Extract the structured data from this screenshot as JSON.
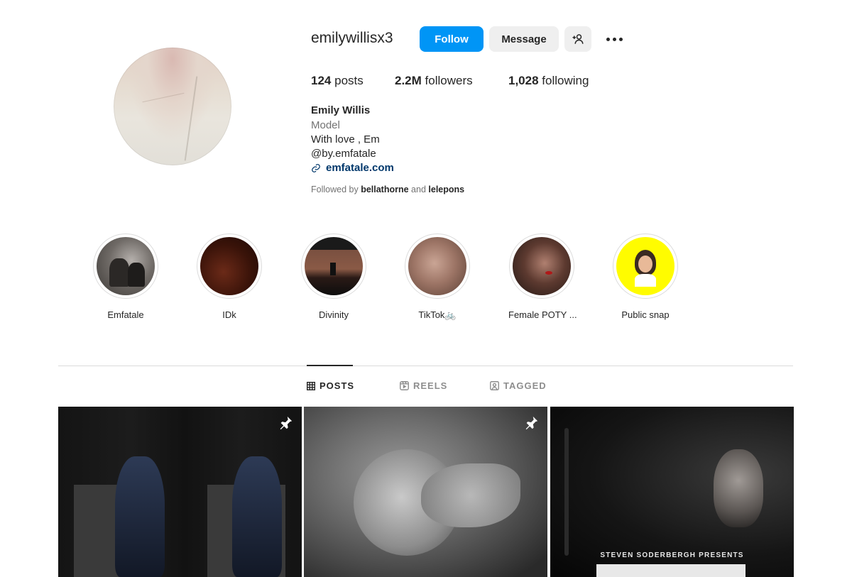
{
  "profile": {
    "username": "emilywillisx3",
    "follow_label": "Follow",
    "message_label": "Message",
    "stats": {
      "posts_count": "124",
      "posts_label": "posts",
      "followers_count": "2.2M",
      "followers_label": "followers",
      "following_count": "1,028",
      "following_label": "following"
    },
    "name": "Emily Willis",
    "category": "Model",
    "bio_lines": [
      "With love , Em",
      "@by.emfatale"
    ],
    "link": "emfatale.com",
    "followed_by": {
      "prefix": "Followed by",
      "user1": "bellathorne",
      "conj": "and",
      "user2": "lelepons"
    }
  },
  "highlights": [
    {
      "label": "Emfatale"
    },
    {
      "label": "IDk"
    },
    {
      "label": "Divinity"
    },
    {
      "label": "TikTok🚲"
    },
    {
      "label": "Female POTY ..."
    },
    {
      "label": "Public snap"
    }
  ],
  "tabs": [
    {
      "label": "POSTS",
      "active": true
    },
    {
      "label": "REELS",
      "active": false
    },
    {
      "label": "TAGGED",
      "active": false
    }
  ],
  "posts": [
    {
      "pinned": true
    },
    {
      "pinned": true
    },
    {
      "pinned": false,
      "overlay_text": "STEVEN SODERBERGH PRESENTS"
    }
  ],
  "colors": {
    "accent": "#0095f6",
    "link": "#00376b",
    "muted": "#737373"
  }
}
